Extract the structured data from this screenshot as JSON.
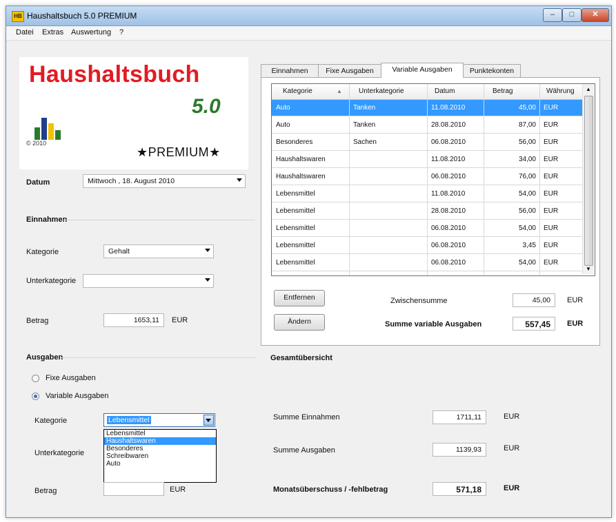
{
  "window": {
    "title": "Haushaltsbuch 5.0 PREMIUM",
    "icon": "HB"
  },
  "menu": [
    "Datei",
    "Extras",
    "Auswertung",
    "?"
  ],
  "logo": {
    "title": "Haushaltsbuch",
    "version": "5.0",
    "year": "© 2010",
    "premium": "★PREMIUM★"
  },
  "datum": {
    "label": "Datum",
    "value": "Mittwoch ,  18.   August   2010"
  },
  "einnahmen": {
    "header": "Einnahmen",
    "kategorie_label": "Kategorie",
    "kategorie_value": "Gehalt",
    "unterkategorie_label": "Unterkategorie",
    "unterkategorie_value": "",
    "betrag_label": "Betrag",
    "betrag_value": "1653,11",
    "currency": "EUR"
  },
  "ausgaben": {
    "header": "Ausgaben",
    "radio_fixe": "Fixe Ausgaben",
    "radio_variable": "Variable Ausgaben",
    "kategorie_label": "Kategorie",
    "kategorie_value": "Lebensmittel",
    "dropdown_options": [
      "Lebensmittel",
      "Haushaltswaren",
      "Besonderes",
      "Schreibwaren",
      "Auto"
    ],
    "dropdown_selected": 1,
    "unterkategorie_label": "Unterkategorie",
    "betrag_label": "Betrag",
    "betrag_value": "",
    "currency": "EUR"
  },
  "tabs": [
    "Einnahmen",
    "Fixe Ausgaben",
    "Variable Ausgaben",
    "Punktekonten"
  ],
  "active_tab": 2,
  "table": {
    "columns": [
      "Kategorie",
      "Unterkategorie",
      "Datum",
      "Betrag",
      "Währung"
    ],
    "rows": [
      [
        "Auto",
        "Tanken",
        "11.08.2010",
        "45,00",
        "EUR"
      ],
      [
        "Auto",
        "Tanken",
        "28.08.2010",
        "87,00",
        "EUR"
      ],
      [
        "Besonderes",
        "Sachen",
        "06.08.2010",
        "56,00",
        "EUR"
      ],
      [
        "Haushaltswaren",
        "",
        "11.08.2010",
        "34,00",
        "EUR"
      ],
      [
        "Haushaltswaren",
        "",
        "06.08.2010",
        "76,00",
        "EUR"
      ],
      [
        "Lebensmittel",
        "",
        "11.08.2010",
        "54,00",
        "EUR"
      ],
      [
        "Lebensmittel",
        "",
        "28.08.2010",
        "56,00",
        "EUR"
      ],
      [
        "Lebensmittel",
        "",
        "06.08.2010",
        "54,00",
        "EUR"
      ],
      [
        "Lebensmittel",
        "",
        "06.08.2010",
        "3,45",
        "EUR"
      ],
      [
        "Lebensmittel",
        "",
        "06.08.2010",
        "54,00",
        "EUR"
      ]
    ],
    "selected_row": 0
  },
  "actions": {
    "entfernen": "Entfernen",
    "aendern": "Ändern"
  },
  "zwischensumme": {
    "label": "Zwischensumme",
    "value": "45,00",
    "currency": "EUR"
  },
  "summe_variable": {
    "label": "Summe variable Ausgaben",
    "value": "557,45",
    "currency": "EUR"
  },
  "gesamt": {
    "header": "Gesamtübersicht",
    "einnahmen_label": "Summe Einnahmen",
    "einnahmen_value": "1711,11",
    "ausgaben_label": "Summe Ausgaben",
    "ausgaben_value": "1139,93",
    "ueberschuss_label": "Monatsüberschuss / -fehlbetrag",
    "ueberschuss_value": "571,18",
    "currency": "EUR"
  },
  "colors": {
    "selection": "#3399ff",
    "logo_red": "#e21b23",
    "logo_green": "#2b7a2b"
  }
}
